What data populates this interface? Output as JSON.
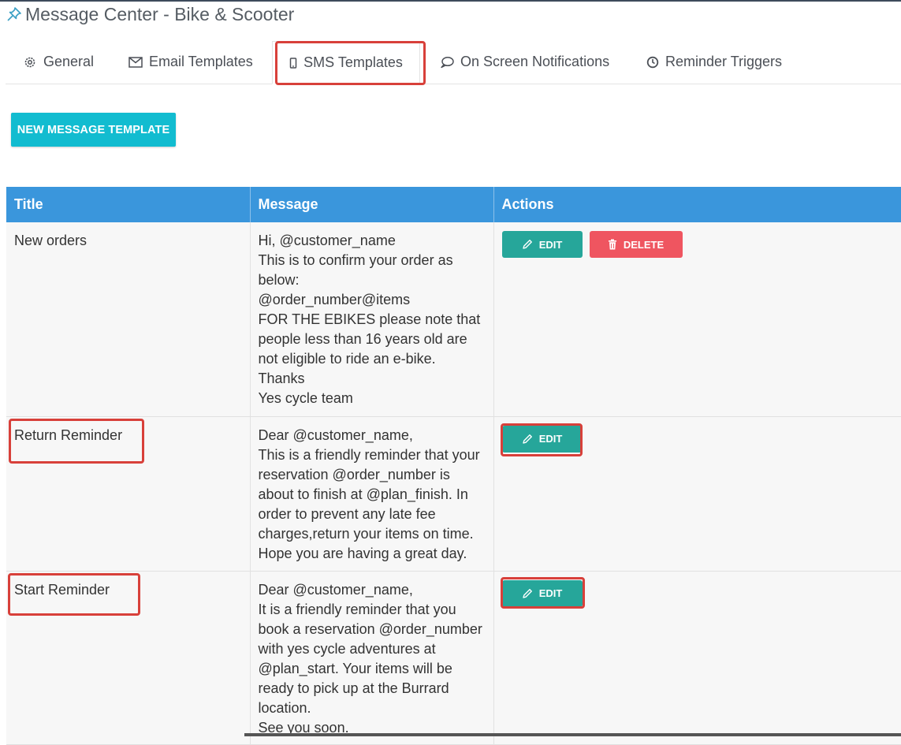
{
  "header": {
    "title": "Message Center - Bike & Scooter"
  },
  "tabs": [
    {
      "label": "General",
      "icon": "gear-icon"
    },
    {
      "label": "Email Templates",
      "icon": "envelope-icon"
    },
    {
      "label": "SMS Templates",
      "icon": "mobile-icon",
      "active": true
    },
    {
      "label": "On Screen Notifications",
      "icon": "speech-bubble-icon"
    },
    {
      "label": "Reminder Triggers",
      "icon": "clock-icon"
    }
  ],
  "toolbar": {
    "new_template_label": "NEW MESSAGE TEMPLATE"
  },
  "table": {
    "headers": [
      "Title",
      "Message",
      "Actions"
    ],
    "rows": [
      {
        "title": "New orders",
        "message": [
          "Hi, @customer_name",
          "This is to confirm your order as below:",
          "@order_number@items",
          "FOR THE EBIKES please note that people less than 16 years old are not eligible to ride an e-bike.",
          "Thanks",
          "Yes cycle team"
        ],
        "edit_label": "EDIT",
        "delete_label": "DELETE"
      },
      {
        "title": "Return Reminder",
        "message": [
          "Dear @customer_name,",
          "This is a friendly reminder that your reservation @order_number is about to finish at @plan_finish. In order to prevent any late fee charges,return your items on time.",
          "Hope you are having a great day."
        ],
        "edit_label": "EDIT"
      },
      {
        "title": "Start Reminder",
        "message": [
          "Dear @customer_name,",
          "It is a friendly reminder that you book a reservation @order_number with yes cycle adventures at @plan_start. Your items will be ready to pick up at the Burrard location.",
          "See you soon."
        ],
        "edit_label": "EDIT"
      }
    ]
  },
  "colors": {
    "header_bg": "#3a96dc",
    "primary_btn": "#12bcd0",
    "edit_btn": "#26a69a",
    "delete_btn": "#ef5560",
    "highlight": "#d8403a"
  }
}
